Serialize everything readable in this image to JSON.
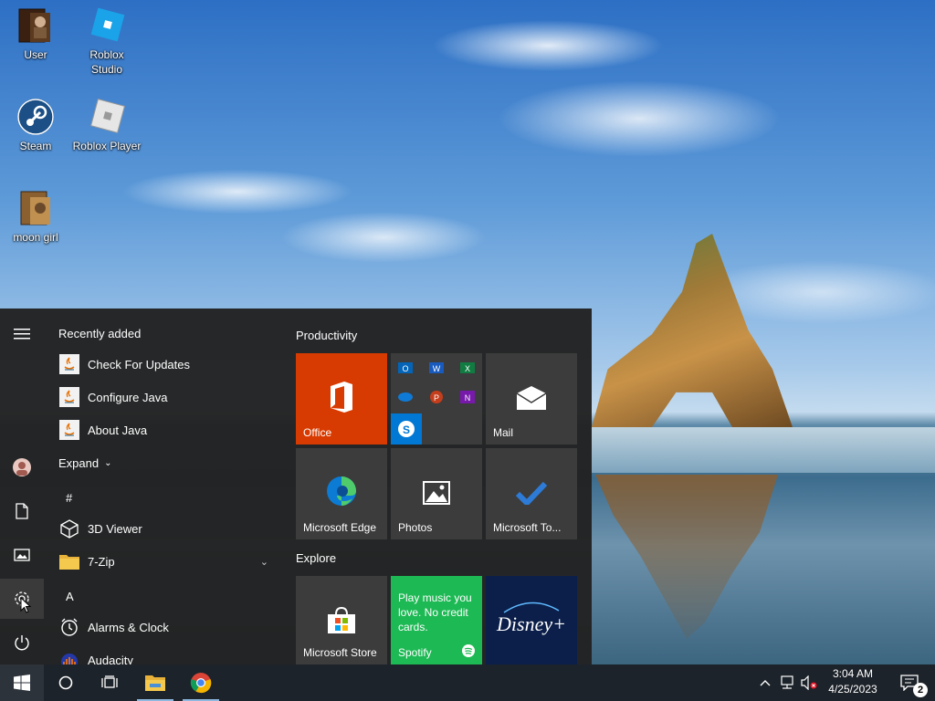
{
  "desktop": {
    "icons": [
      {
        "label": "User"
      },
      {
        "label": "Roblox\nStudio"
      },
      {
        "label": "Steam"
      },
      {
        "label": "Roblox Player"
      },
      {
        "label": "moon girl"
      }
    ]
  },
  "start_menu": {
    "recently_added_label": "Recently added",
    "recent": [
      {
        "label": "Check For Updates"
      },
      {
        "label": "Configure Java"
      },
      {
        "label": "About Java"
      }
    ],
    "expand_label": "Expand",
    "apps": {
      "hash_header": "#",
      "viewer": "3D Viewer",
      "zip": "7-Zip",
      "a_header": "A",
      "alarms": "Alarms & Clock",
      "audacity": "Audacity"
    },
    "groups": {
      "productivity": "Productivity",
      "explore": "Explore"
    },
    "tiles": {
      "office": "Office",
      "mail": "Mail",
      "edge": "Microsoft Edge",
      "photos": "Photos",
      "todo": "Microsoft To...",
      "store": "Microsoft Store",
      "spotify": "Spotify",
      "spotify_promo": "Play music you love. No credit cards."
    }
  },
  "taskbar": {
    "time": "3:04 AM",
    "date": "4/25/2023",
    "notification_count": "2"
  },
  "colors": {
    "office": "#d83b01",
    "spotify": "#1db954",
    "disney": "#0b1f4a",
    "skype": "#0078d4",
    "accent": "#8fb8e0"
  }
}
